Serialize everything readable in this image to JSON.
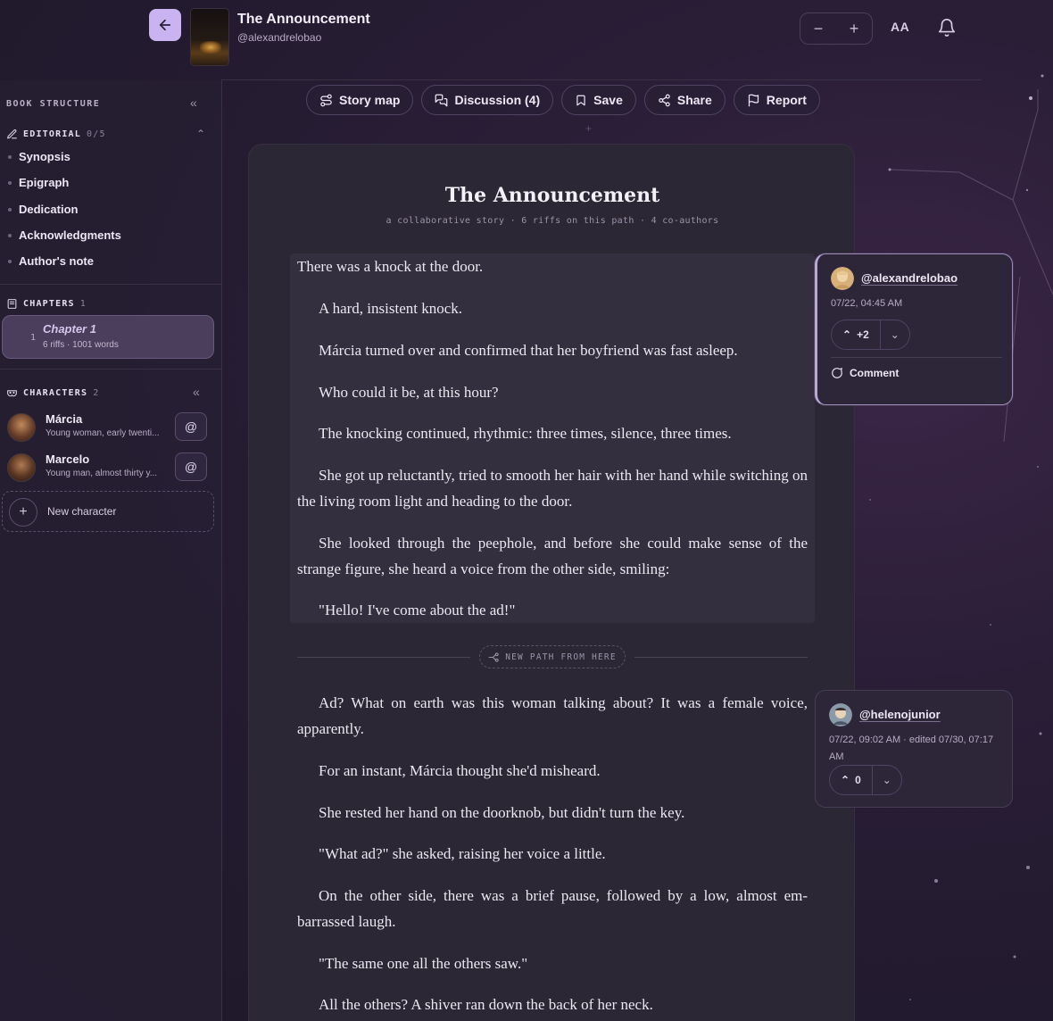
{
  "header": {
    "book_title": "The Announcement",
    "author_handle": "@alexandrelobao",
    "font_size_label": "AA"
  },
  "sidebar": {
    "heading": "BOOK STRUCTURE",
    "editorial": {
      "label": "EDITORIAL",
      "count": "0/5",
      "items": [
        {
          "label": "Synopsis"
        },
        {
          "label": "Epigraph"
        },
        {
          "label": "Dedication"
        },
        {
          "label": "Acknowledgments"
        },
        {
          "label": "Author's note"
        }
      ]
    },
    "chapters": {
      "label": "CHAPTERS",
      "count": "1",
      "items": [
        {
          "number": "1",
          "title": "Chapter 1",
          "meta": "6 riffs · 1001 words"
        }
      ]
    },
    "characters": {
      "label": "CHARACTERS",
      "count": "2",
      "items": [
        {
          "name": "Márcia",
          "description": "Young woman, early twenti...",
          "mention": "@"
        },
        {
          "name": "Marcelo",
          "description": "Young man, almost thirty y...",
          "mention": "@"
        }
      ],
      "new_label": "New character"
    }
  },
  "toolbar": {
    "story_map": "Story map",
    "discussion": "Discussion (4)",
    "save": "Save",
    "share": "Share",
    "report": "Report"
  },
  "story": {
    "title": "The Announcement",
    "subtitle": "a collaborative story · 6 riffs on this path · 4 co-authors",
    "riff1": [
      "There was a knock at the door.",
      "A hard, insistent knock.",
      "Márcia turned over and confirmed that her boyfriend was fast asleep.",
      "Who could it be, at this hour?",
      "The knocking continued, rhythmic: three times, silence, three times.",
      "She got up reluctantly, tried to smooth her hair with her hand while switching on the living room light and heading to the door.",
      "She looked through the peephole, and before she could make sense of the strange figure, she heard a voice from the other side, smiling:",
      "\"Hello! I've come about the ad!\""
    ],
    "branch_label": "NEW PATH FROM HERE",
    "riff2": [
      "Ad? What on earth was this woman talking about? It was a female voice, apparently.",
      "For an instant, Márcia thought she'd misheard.",
      "She rested her hand on the doorknob, but didn't turn the key.",
      "\"What ad?\" she asked, raising her voice a little.",
      "On the other side, there was a brief pause, followed by a low, almost em-barrassed laugh.",
      "\"The same one all the others saw.\"",
      "All the others? A shiver ran down the back of her neck."
    ]
  },
  "comments": [
    {
      "user": "@alexandrelobao",
      "time": "07/22, 04:45 AM",
      "votes": "+2",
      "comment_label": "Comment"
    },
    {
      "user": "@helenojunior",
      "time": "07/22, 09:02 AM · edited 07/30, 07:17 AM",
      "votes": "0"
    }
  ],
  "colors": {
    "accent": "#c9b3f0",
    "background": "#221a2e",
    "panel": "#2b2735"
  }
}
